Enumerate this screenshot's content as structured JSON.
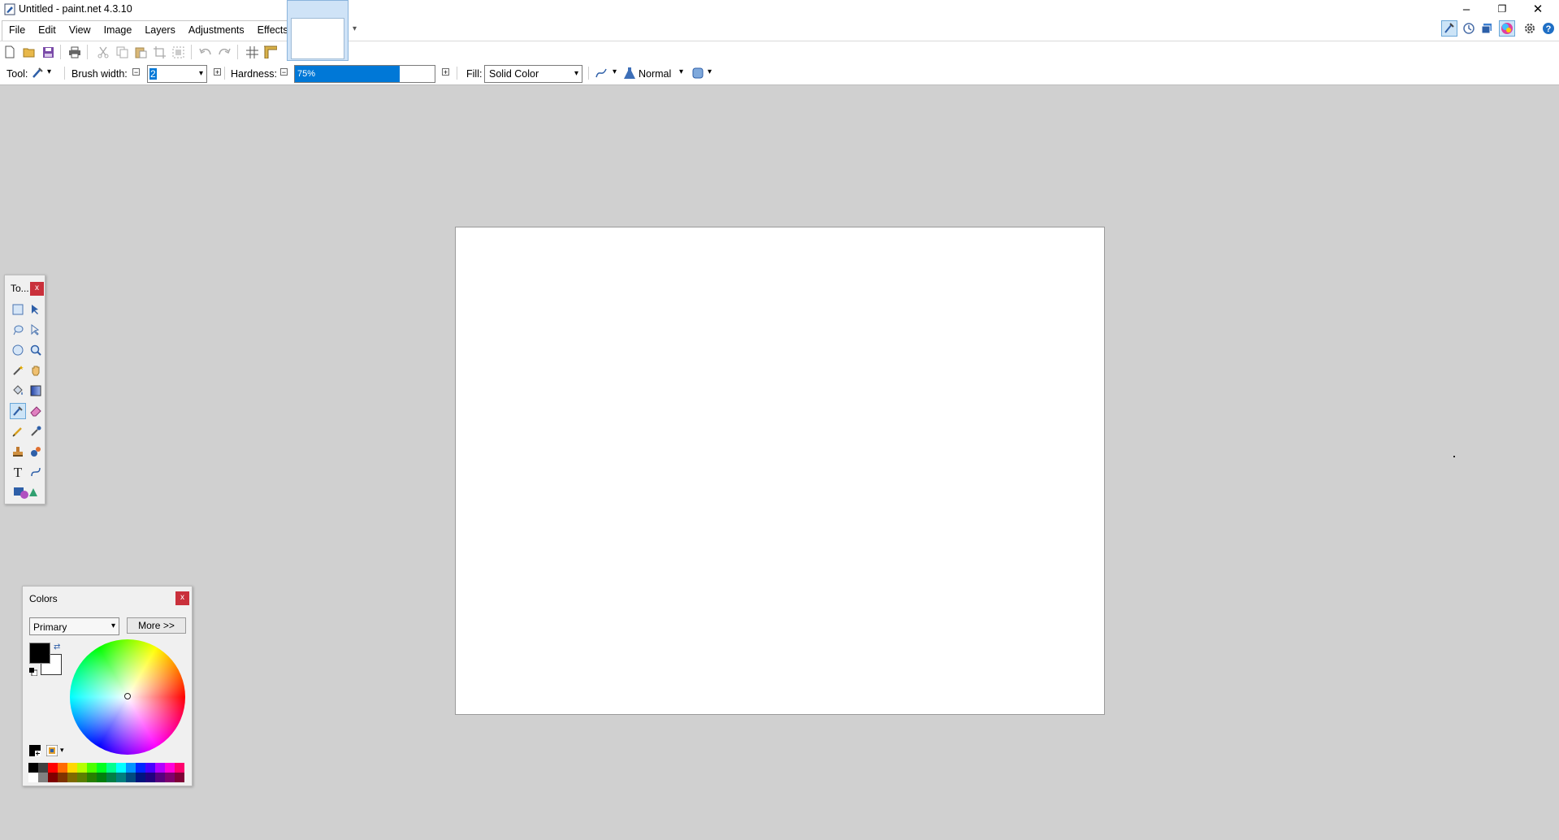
{
  "window": {
    "title": "Untitled - paint.net 4.3.10",
    "minimize_glyph": "–",
    "restore_glyph": "❐",
    "close_glyph": "✕"
  },
  "menu": [
    "File",
    "Edit",
    "View",
    "Image",
    "Layers",
    "Adjustments",
    "Effects"
  ],
  "toolbar": {
    "icons": [
      "new-icon",
      "open-icon",
      "save-icon",
      "print-icon",
      "cut-icon",
      "copy-icon",
      "paste-icon",
      "crop-icon",
      "deselect-icon",
      "undo-icon",
      "redo-icon",
      "grid-icon",
      "ruler-icon"
    ]
  },
  "right_icons": [
    "tools-panel-icon",
    "history-icon",
    "layers-icon",
    "colors-icon",
    "settings-icon",
    "help-icon"
  ],
  "options": {
    "tool_label": "Tool:",
    "brush_width_label": "Brush width:",
    "brush_width_value": "2",
    "hardness_label": "Hardness:",
    "hardness_value": "75%",
    "hardness_fraction": 0.75,
    "fill_label": "Fill:",
    "fill_value": "Solid Color",
    "blend_mode": "Normal"
  },
  "tools_window": {
    "title": "To...",
    "close": "x",
    "tools": [
      "rectangle-select",
      "move-selected",
      "lasso-select",
      "move-selection",
      "ellipse-select",
      "zoom",
      "magic-wand",
      "pan",
      "paint-bucket",
      "gradient",
      "paintbrush",
      "eraser",
      "pencil",
      "color-picker",
      "clone-stamp",
      "recolor",
      "text",
      "line-curve",
      "shapes"
    ],
    "selected": "paintbrush"
  },
  "colors_window": {
    "title": "Colors",
    "close": "x",
    "mode": "Primary",
    "more_label": "More >>",
    "primary_color": "#000000",
    "secondary_color": "#ffffff",
    "palette_top": [
      "#000000",
      "#404040",
      "#ff0000",
      "#ff6a00",
      "#ffd800",
      "#b6ff00",
      "#4cff00",
      "#00ff21",
      "#00ff90",
      "#00ffff",
      "#0094ff",
      "#0026ff",
      "#4800ff",
      "#b200ff",
      "#ff00dc",
      "#ff006e"
    ],
    "palette_bottom": [
      "#ffffff",
      "#808080",
      "#7f0000",
      "#7f3300",
      "#7f6a00",
      "#5b7f00",
      "#267f00",
      "#007f0e",
      "#007f46",
      "#007f7f",
      "#004a7f",
      "#00137f",
      "#21007f",
      "#57007f",
      "#7f006e",
      "#7f0037"
    ]
  }
}
